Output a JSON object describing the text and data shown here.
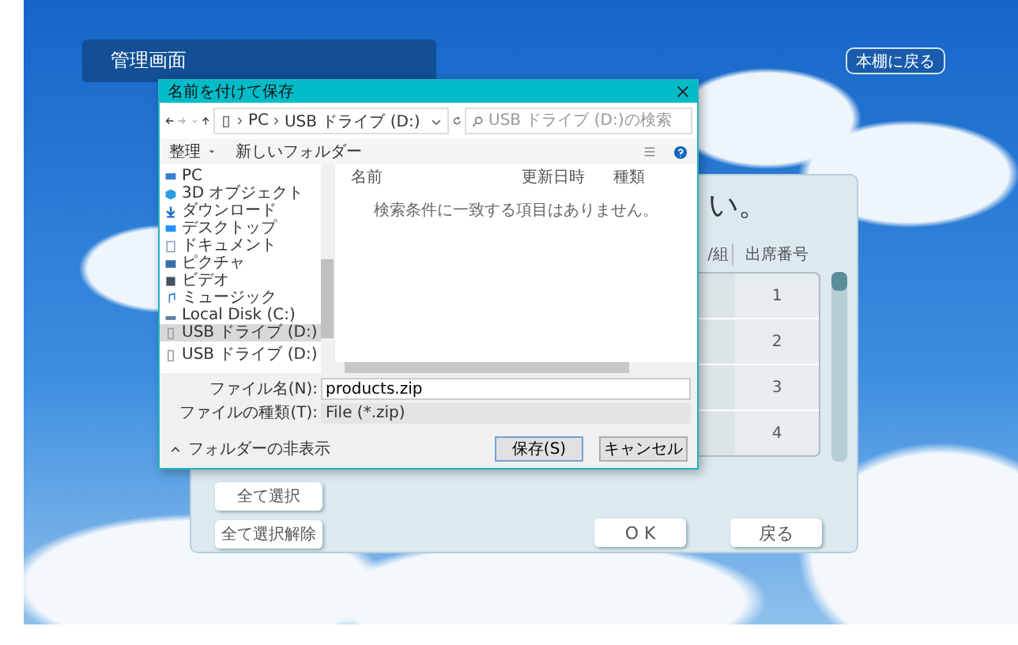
{
  "header": {
    "title": "管理画面",
    "back_button": "本棚に戻る"
  },
  "panel": {
    "heading": "い。",
    "columns": [
      "/組",
      "出席番号"
    ],
    "rows": [
      {
        "number": "1"
      },
      {
        "number": "2"
      },
      {
        "number": "3"
      },
      {
        "number": "4"
      }
    ],
    "select_all": "全て選択",
    "deselect_all": "全て選択解除",
    "ok": "O K",
    "back": "戻る"
  },
  "dialog": {
    "title": "名前を付けて保存",
    "address": [
      "PC",
      "USB ドライブ (D:)"
    ],
    "search": {
      "placeholder": "USB ドライブ (D:)の検索"
    },
    "toolbar": {
      "organize": "整理",
      "new_folder": "新しいフォルダー"
    },
    "nav_items": [
      {
        "kind": "pc",
        "label": "PC",
        "selected": false
      },
      {
        "kind": "cube",
        "label": "3D オブジェクト",
        "selected": false
      },
      {
        "kind": "download",
        "label": "ダウンロード",
        "selected": false
      },
      {
        "kind": "desktop",
        "label": "デスクトップ",
        "selected": false
      },
      {
        "kind": "document",
        "label": "ドキュメント",
        "selected": false
      },
      {
        "kind": "picture",
        "label": "ピクチャ",
        "selected": false
      },
      {
        "kind": "video",
        "label": "ビデオ",
        "selected": false
      },
      {
        "kind": "music",
        "label": "ミュージック",
        "selected": false
      },
      {
        "kind": "disk",
        "label": "Local Disk (C:)",
        "selected": false
      },
      {
        "kind": "usb",
        "label": "USB ドライブ (D:)",
        "selected": true
      }
    ],
    "nav_extra": {
      "kind": "usb",
      "label": "USB ドライブ (D:)"
    },
    "columns": [
      "名前",
      "更新日時",
      "種類"
    ],
    "empty_message": "検索条件に一致する項目はありません。",
    "file_name": {
      "label": "ファイル名(N):",
      "value": "products.zip"
    },
    "file_type": {
      "label": "ファイルの種類(T):",
      "value": "File (*.zip)"
    },
    "hide_folders": "フォルダーの非表示",
    "save": "保存(S)",
    "cancel": "キャンセル"
  }
}
